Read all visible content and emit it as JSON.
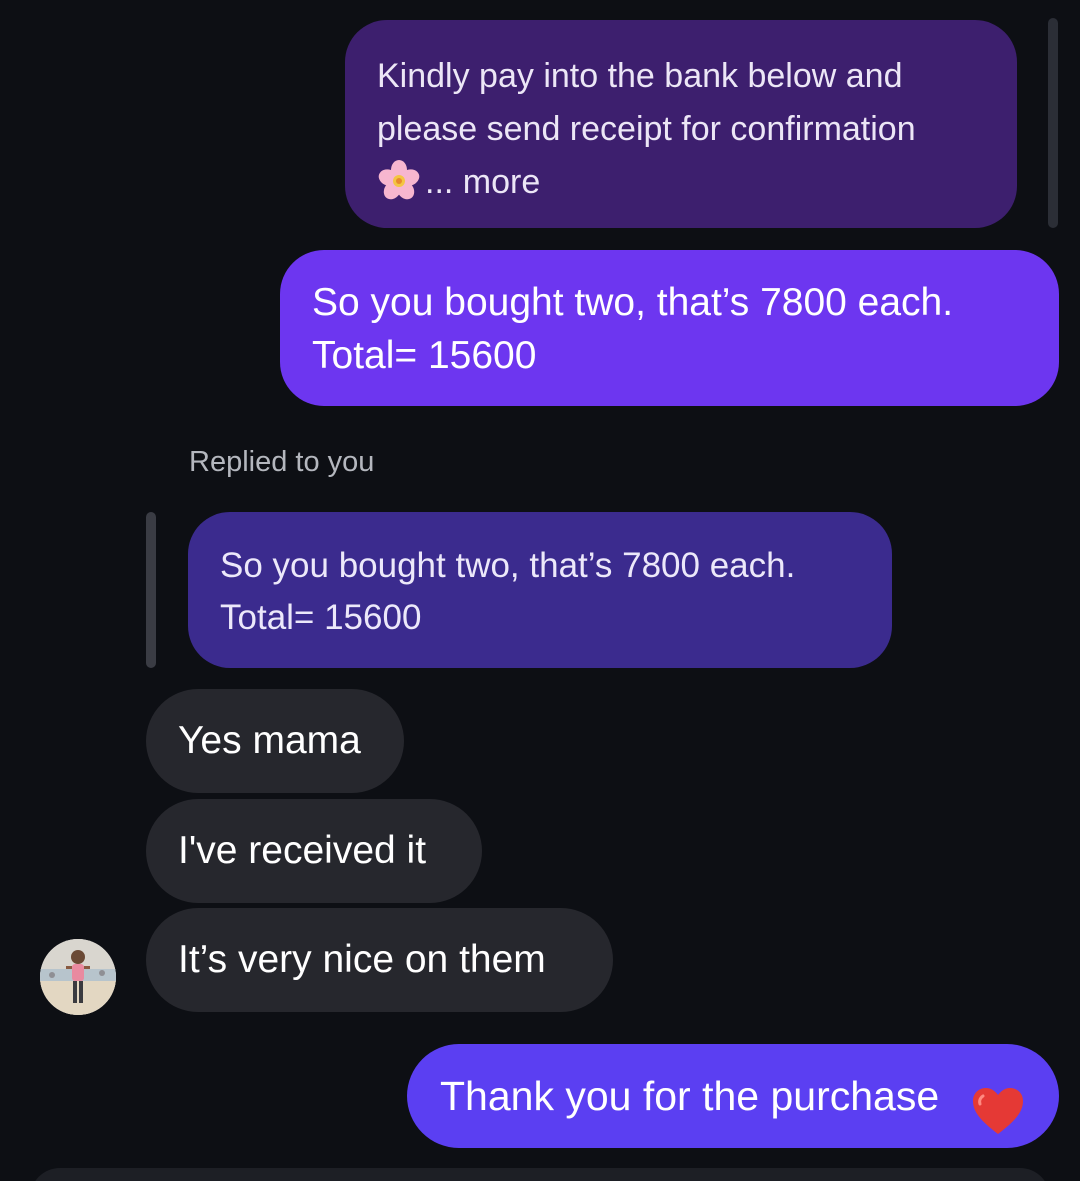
{
  "colors": {
    "background": "#0d0f14",
    "sent_quoted_bubble": "#3d1f6e",
    "sent_bubble": "#6d36f0",
    "reply_quote_bubble": "#3b2b8e",
    "received_bubble": "#26272d",
    "sent_last_bubble": "#5b3ff2",
    "heart": "#e53935"
  },
  "messages": {
    "bank_message": {
      "line1": "Kindly pay into the bank below and",
      "line2": "please send receipt for confirmation",
      "emoji": "cherry-blossom-icon",
      "more": "... more"
    },
    "total_message": {
      "line1": "So you bought two, that’s 7800 each.",
      "line2": "Total= 15600"
    },
    "reply_label": "Replied to you",
    "quoted_reply": {
      "line1": "So you bought two, that’s 7800 each.",
      "line2": "Total= 15600"
    },
    "received": [
      "Yes mama",
      "I've received it",
      "It’s very nice on them"
    ],
    "thanks_message": {
      "text": "Thank you for the purchase",
      "emoji": "red-heart-icon"
    }
  }
}
